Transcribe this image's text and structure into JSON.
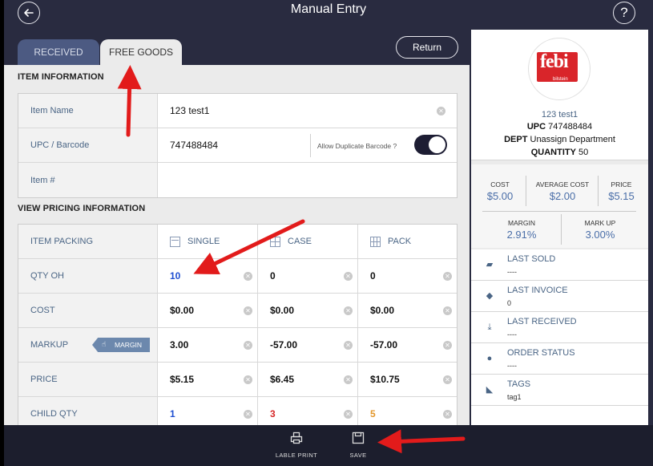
{
  "header": {
    "title": "Manual Entry",
    "help_glyph": "?"
  },
  "tabs": [
    {
      "label": "RECEIVED",
      "active": false
    },
    {
      "label": "FREE GOODS",
      "active": true
    }
  ],
  "return_label": "Return",
  "sections": {
    "item_info": "ITEM INFORMATION",
    "pricing": "VIEW PRICING INFORMATION"
  },
  "item_info": {
    "name_label": "Item Name",
    "name_value": "123 test1",
    "upc_label": "UPC / Barcode",
    "upc_value": "747488484",
    "allow_dup_label": "Allow Duplicate Barcode ?",
    "allow_dup_on": true,
    "item_no_label": "Item #",
    "item_no_value": ""
  },
  "pricing": {
    "headers": {
      "row_label": "ITEM PACKING",
      "single": "SINGLE",
      "case": "CASE",
      "pack": "PACK"
    },
    "margin_button": "MARGIN",
    "rows": [
      {
        "label": "QTY OH",
        "single": "10",
        "case": "0",
        "pack": "0"
      },
      {
        "label": "COST",
        "single": "$0.00",
        "case": "$0.00",
        "pack": "$0.00"
      },
      {
        "label": "MARKUP",
        "single": "3.00",
        "case": "-57.00",
        "pack": "-57.00"
      },
      {
        "label": "PRICE",
        "single": "$5.15",
        "case": "$6.45",
        "pack": "$10.75"
      },
      {
        "label": "CHILD QTY",
        "single": "1",
        "case": "3",
        "pack": "5"
      }
    ]
  },
  "product": {
    "logo_text": "febi",
    "logo_subtext": "bilstein",
    "name": "123 test1",
    "upc_label": "UPC",
    "upc": "747488484",
    "dept_label": "DEPT",
    "dept": "Unassign Department",
    "qty_label": "QUANTITY",
    "qty": "50"
  },
  "stats": {
    "cost_label": "COST",
    "cost": "$5.00",
    "avg_label": "AVERAGE COST",
    "avg": "$2.00",
    "price_label": "PRICE",
    "price": "$5.15",
    "margin_label": "MARGIN",
    "margin": "2.91%",
    "markup_label": "MARK UP",
    "markup": "3.00%"
  },
  "info": [
    {
      "title": "LAST SOLD",
      "value": "----",
      "icon": "bag-icon"
    },
    {
      "title": "LAST INVOICE",
      "value": "0",
      "icon": "stack-icon"
    },
    {
      "title": "LAST RECEIVED",
      "value": "----",
      "icon": "tray-icon"
    },
    {
      "title": "ORDER STATUS",
      "value": "----",
      "icon": "stopwatch-icon"
    },
    {
      "title": "TAGS",
      "value": "tag1",
      "icon": "tag-icon"
    }
  ],
  "bottom": {
    "print_label": "LABLE PRINT",
    "save_label": "SAVE"
  },
  "colors": {
    "navy": "#292b40",
    "link_blue": "#4a6585",
    "qty_single": "#1f4fd1",
    "qty_case": "#d62828",
    "qty_pack": "#e2962a",
    "annotation": "#e21b1b"
  }
}
